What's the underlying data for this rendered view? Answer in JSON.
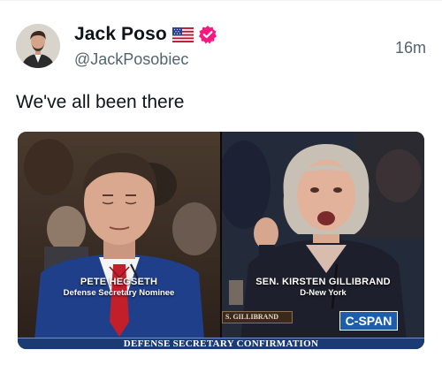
{
  "post": {
    "author": {
      "display_name": "Jack Poso",
      "handle": "@JackPosobiec",
      "flag_icon": "us-flag-icon",
      "verified_icon": "verified-badge-icon"
    },
    "timestamp": "16m",
    "text": "We've all been there"
  },
  "media": {
    "left_caption": {
      "name": "PETE HEGSETH",
      "subtitle": "Defense Secretary Nominee"
    },
    "right_caption": {
      "name": "SEN. KIRSTEN GILLIBRAND",
      "subtitle": "D-New York"
    },
    "nameplate": "S. GILLIBRAND",
    "network_logo": "C-SPAN",
    "banner": "DEFENSE SECRETARY CONFIRMATION"
  },
  "colors": {
    "verified": "#f91880",
    "secondary_text": "#536471",
    "banner": "#1b3b73",
    "network_logo": "#1e5ea8"
  }
}
